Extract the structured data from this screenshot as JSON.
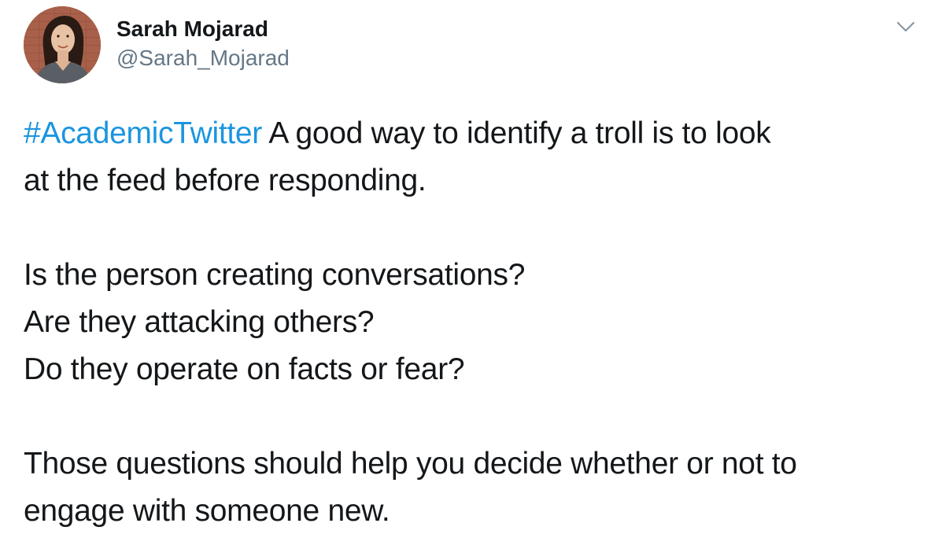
{
  "author": {
    "display_name": "Sarah Mojarad",
    "handle": "@Sarah_Mojarad",
    "avatar_icon": "profile-photo",
    "menu_icon": "chevron-down-icon"
  },
  "tweet": {
    "hashtag": "#AcademicTwitter",
    "line1_rest": " A good way to identify a troll is to look",
    "line2": "at the feed before responding.",
    "line3": "Is the person creating conversations?",
    "line4": "Are they attacking others?",
    "line5": "Do they operate on facts or fear?",
    "line6": "Those questions should help you decide whether or not to",
    "line7": "engage with someone new."
  },
  "colors": {
    "link": "#1b95e0",
    "text": "#14171a",
    "secondary": "#657786"
  }
}
